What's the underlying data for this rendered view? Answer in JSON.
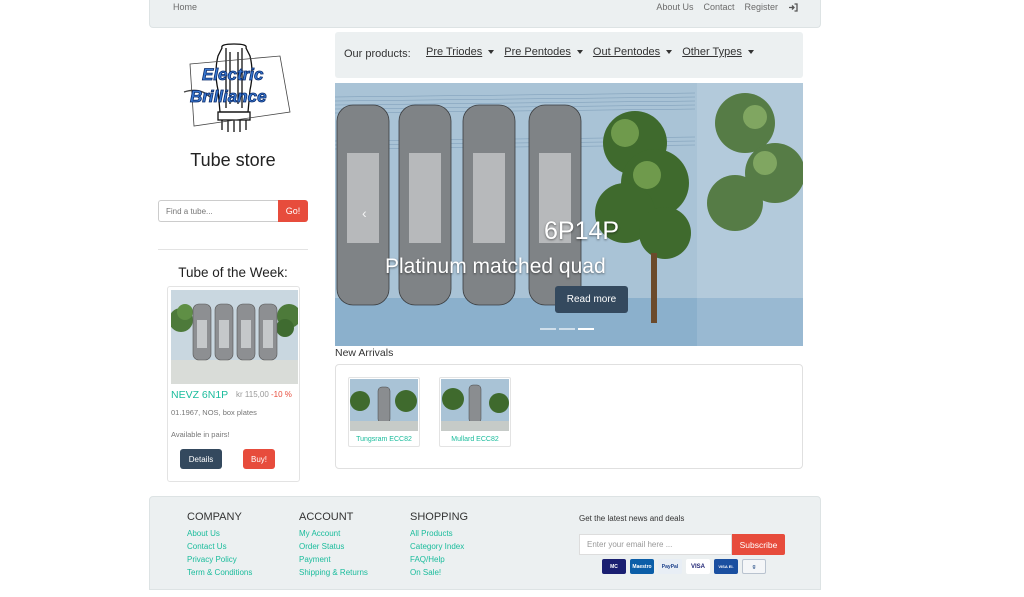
{
  "topnav": {
    "home": "Home",
    "about": "About Us",
    "contact": "Contact",
    "register": "Register",
    "login_icon": "sign-in-icon"
  },
  "sidebar": {
    "logo_text_1": "Electric",
    "logo_text_2": "Brilliance",
    "store_title": "Tube store",
    "search_placeholder": "Find a tube...",
    "search_button": "Go!",
    "tube_of_week_title": "Tube of the Week:",
    "tube": {
      "name": "NEVZ 6N1P",
      "price": "kr 115,00",
      "discount": "-10 %",
      "meta": "01.1967, NOS, box plates",
      "availability": "Available in pairs!",
      "details_button": "Details",
      "buy_button": "Buy!"
    }
  },
  "products": {
    "label": "Our products:",
    "menu": [
      "Pre Triodes",
      "Pre Pentodes",
      "Out Pentodes",
      "Other Types"
    ]
  },
  "carousel": {
    "title": "6P14P",
    "subtitle": "Platinum matched quad",
    "button": "Read more",
    "prev_icon": "chevron-left-icon"
  },
  "new_arrivals": {
    "title": "New Arrivals",
    "items": [
      {
        "caption": "Tungsram ECC82"
      },
      {
        "caption": "Mullard ECC82"
      }
    ]
  },
  "footer": {
    "company": {
      "title": "COMPANY",
      "links": [
        "About Us",
        "Contact Us",
        "Privacy Policy",
        "Term & Conditions"
      ]
    },
    "account": {
      "title": "ACCOUNT",
      "links": [
        "My Account",
        "Order Status",
        "Payment",
        "Shipping & Returns"
      ]
    },
    "shopping": {
      "title": "SHOPPING",
      "links": [
        "All Products",
        "Category Index",
        "FAQ/Help",
        "On Sale!"
      ]
    },
    "newsletter_text": "Get the latest news and deals",
    "email_placeholder": "Enter your email here ...",
    "subscribe": "Subscribe",
    "payment_cards": [
      "MasterCard",
      "Maestro",
      "PayPal",
      "VISA",
      "VISA Electron",
      "Google"
    ]
  },
  "colors": {
    "accent": "#1abc9c",
    "danger": "#e74c3c",
    "dark": "#34495e",
    "panel": "#ecf0f1"
  }
}
